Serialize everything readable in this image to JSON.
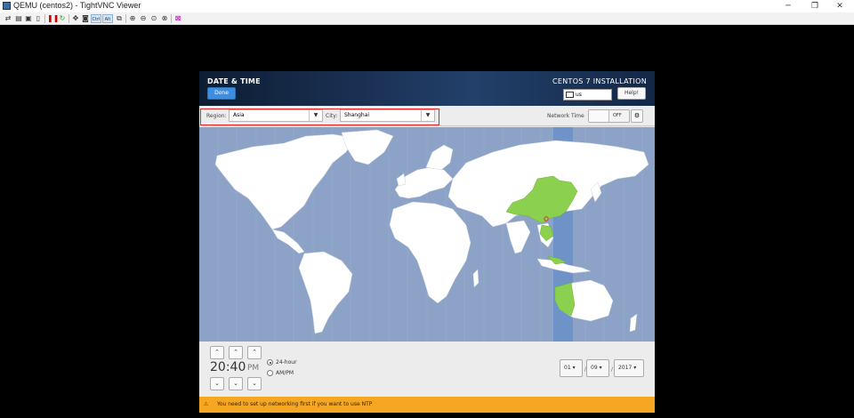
{
  "window": {
    "title": "QEMU (centos2) - TightVNC Viewer"
  },
  "toolbar": {
    "ctrl_label": "Ctrl",
    "alt_label": "Alt"
  },
  "header": {
    "spoke_title": "DATE & TIME",
    "done_label": "Done",
    "installer_title": "CENTOS 7 INSTALLATION",
    "keyboard_layout": "us",
    "help_label": "Help!"
  },
  "controls": {
    "region_label": "Region:",
    "region_value": "Asia",
    "city_label": "City:",
    "city_value": "Shanghai",
    "network_time_label": "Network Time",
    "network_time_state": "OFF"
  },
  "time": {
    "value": "20:40",
    "ampm": "PM",
    "format_24": "24-hour",
    "format_12": "AM/PM",
    "selected_format": "24-hour"
  },
  "date": {
    "month": "01",
    "day": "09",
    "year": "2017",
    "separator": "/"
  },
  "warning": {
    "text": "You need to set up networking first if you want to use NTP"
  },
  "colors": {
    "map_ocean": "#8ca3c7",
    "map_land": "#ffffff",
    "timezone_highlight": "#6d93c9",
    "selected_region": "#8bd04e",
    "warning_bar": "#f5a623",
    "accent": "#3d8ee0"
  }
}
